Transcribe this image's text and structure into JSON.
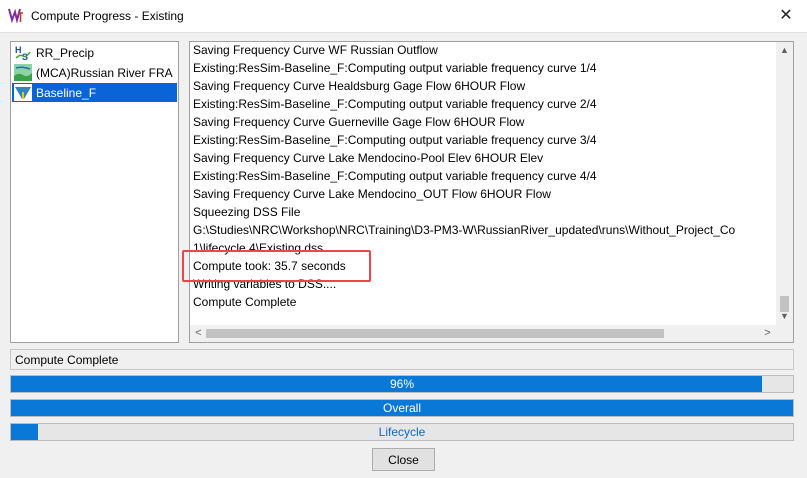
{
  "window": {
    "title": "Compute Progress - Existing",
    "close_glyph": "✕"
  },
  "simulations": [
    {
      "label": "RR_Precip",
      "icon": "hms-icon"
    },
    {
      "label": "(MCA)Russian River FRA",
      "icon": "mca-map-icon"
    },
    {
      "label": "Baseline_F",
      "icon": "ressim-icon",
      "selected": true
    }
  ],
  "log": {
    "lines": [
      "Saving Frequency Curve WF Russian Outflow",
      "Existing:ResSim-Baseline_F:Computing output variable frequency curve 1/4",
      "Saving Frequency Curve Healdsburg Gage Flow 6HOUR Flow",
      "Existing:ResSim-Baseline_F:Computing output variable frequency curve 2/4",
      "Saving Frequency Curve Guerneville Gage Flow 6HOUR Flow",
      "Existing:ResSim-Baseline_F:Computing output variable frequency curve 3/4",
      "Saving Frequency Curve Lake Mendocino-Pool Elev 6HOUR Elev",
      "Existing:ResSim-Baseline_F:Computing output variable frequency curve 4/4",
      "Saving Frequency Curve Lake Mendocino_OUT Flow 6HOUR Flow",
      "Squeezing DSS File",
      "G:\\Studies\\NRC\\Workshop\\NRC\\Training\\D3-PM3-W\\RussianRiver_updated\\runs\\Without_Project_Co",
      "1\\lifecycle 4\\Existing.dss",
      "Compute took: 35.7 seconds",
      "Writing variables to DSS....",
      "Compute Complete"
    ]
  },
  "status": {
    "text": "Compute Complete"
  },
  "progress": {
    "current": {
      "label": "96%",
      "fraction": 0.96
    },
    "overall": {
      "label": "Overall",
      "fraction": 1.0
    },
    "lifecycle": {
      "label": "Lifecycle",
      "fraction": 0.035
    }
  },
  "buttons": {
    "close_label": "Close"
  },
  "colors": {
    "progress_fill": "#0a78d7",
    "selection": "#0a64d8",
    "highlight_box": "#e8474b"
  }
}
